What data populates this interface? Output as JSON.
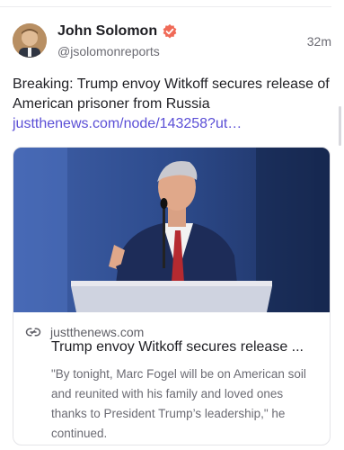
{
  "post": {
    "author": {
      "display_name": "John Solomon",
      "handle": "@jsolomonreports",
      "verified_icon": "verified-badge-icon",
      "avatar": "avatar"
    },
    "timestamp": "32m",
    "text": "Breaking: Trump envoy Witkoff secures release of American prisoner from Russia",
    "link_text": "justthenews.com/node/143258?ut…"
  },
  "card": {
    "image": "photo of a man speaking at a podium",
    "link_icon": "link-icon",
    "domain": "justthenews.com",
    "title": "Trump envoy Witkoff secures release ...",
    "description": "\"By tonight, Marc Fogel will be on American soil and reunited with his family and loved ones thanks to President Trump’s leadership,\" he continued."
  },
  "colors": {
    "link": "#5b4fd6",
    "verified": "#f06a57",
    "muted_text": "#6b6b73"
  }
}
